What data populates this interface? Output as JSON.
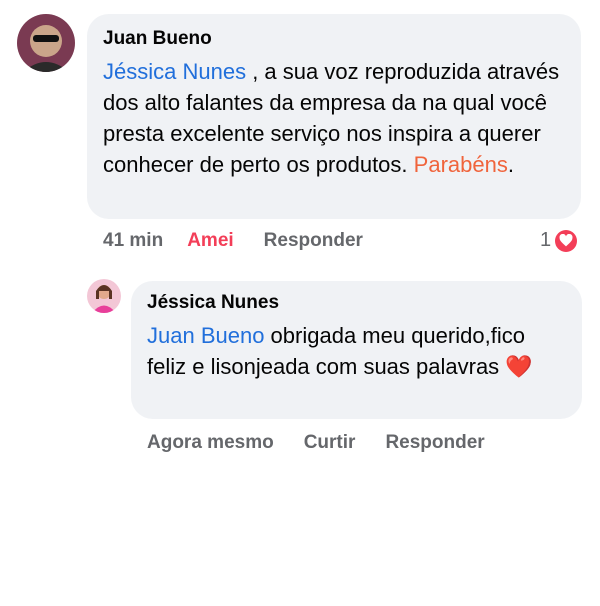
{
  "comment": {
    "author": "Juan Bueno",
    "mention": "Jéssica Nunes",
    "text_after_mention": " , a sua voz reproduzida através dos alto falantes da empresa da na qual você presta excelente serviço nos inspira a querer conhecer de perto os produtos. ",
    "highlight": "Parabéns",
    "text_end": ".",
    "time": "41 min",
    "reacted_label": "Amei",
    "reply_label": "Responder",
    "reaction_count": "1",
    "reaction_icon": "love-reaction-icon"
  },
  "reply": {
    "author": "Jéssica Nunes",
    "mention": "Juan Bueno",
    "text_after_mention": " obrigada meu querido,fico feliz e lisonjeada com suas palavras ",
    "emoji": "❤️",
    "time": "Agora mesmo",
    "like_label": "Curtir",
    "reply_label": "Responder"
  },
  "colors": {
    "mention": "#216fdb",
    "highlight": "#f0643c",
    "love": "#f33e58",
    "bubble": "#f0f2f5",
    "meta": "#65676b"
  }
}
